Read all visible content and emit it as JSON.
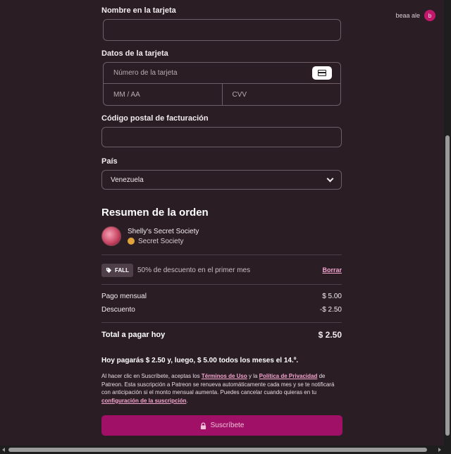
{
  "user": {
    "name": "beaa ale",
    "initial": "b"
  },
  "form": {
    "name_label": "Nombre en la tarjeta",
    "name_value": "",
    "card_label": "Datos de la tarjeta",
    "card_number_placeholder": "Número de la tarjeta",
    "expiry_placeholder": "MM / AA",
    "cvv_placeholder": "CVV",
    "postal_label": "Código postal de facturación",
    "postal_value": "",
    "country_label": "País",
    "country_value": "Venezuela"
  },
  "summary": {
    "title": "Resumen de la orden",
    "creator_name": "Shelly's Secret Society",
    "tier_name": "Secret Society",
    "promo_code": "FALL",
    "promo_text": "50% de descuento en el primer mes",
    "remove_label": "Borrar",
    "monthly_label": "Pago mensual",
    "monthly_value": "$ 5.00",
    "discount_label": "Descuento",
    "discount_value": "-$ 2.50",
    "total_label": "Total a pagar hoy",
    "total_value": "$ 2.50",
    "today_note": "Hoy pagarás $ 2.50 y, luego, $ 5.00 todos los meses el 14.º."
  },
  "legal": {
    "part1": "Al hacer clic en Suscríbete, aceptas los ",
    "terms_link": "Términos de Uso",
    "part2": " y la ",
    "privacy_link": "Política de Privacidad",
    "part3": " de Patreon. Esta suscripción a Patreon se renueva automáticamente cada mes y se te notificará con anticipación si el monto mensual aumenta. Puedes cancelar cuando quieras en tu ",
    "settings_link": "configuración de la suscripción",
    "part4": "."
  },
  "subscribe_label": "Suscríbete",
  "colors": {
    "background": "#2b1d24",
    "accent": "#a01066",
    "link": "#f4a6d0"
  }
}
